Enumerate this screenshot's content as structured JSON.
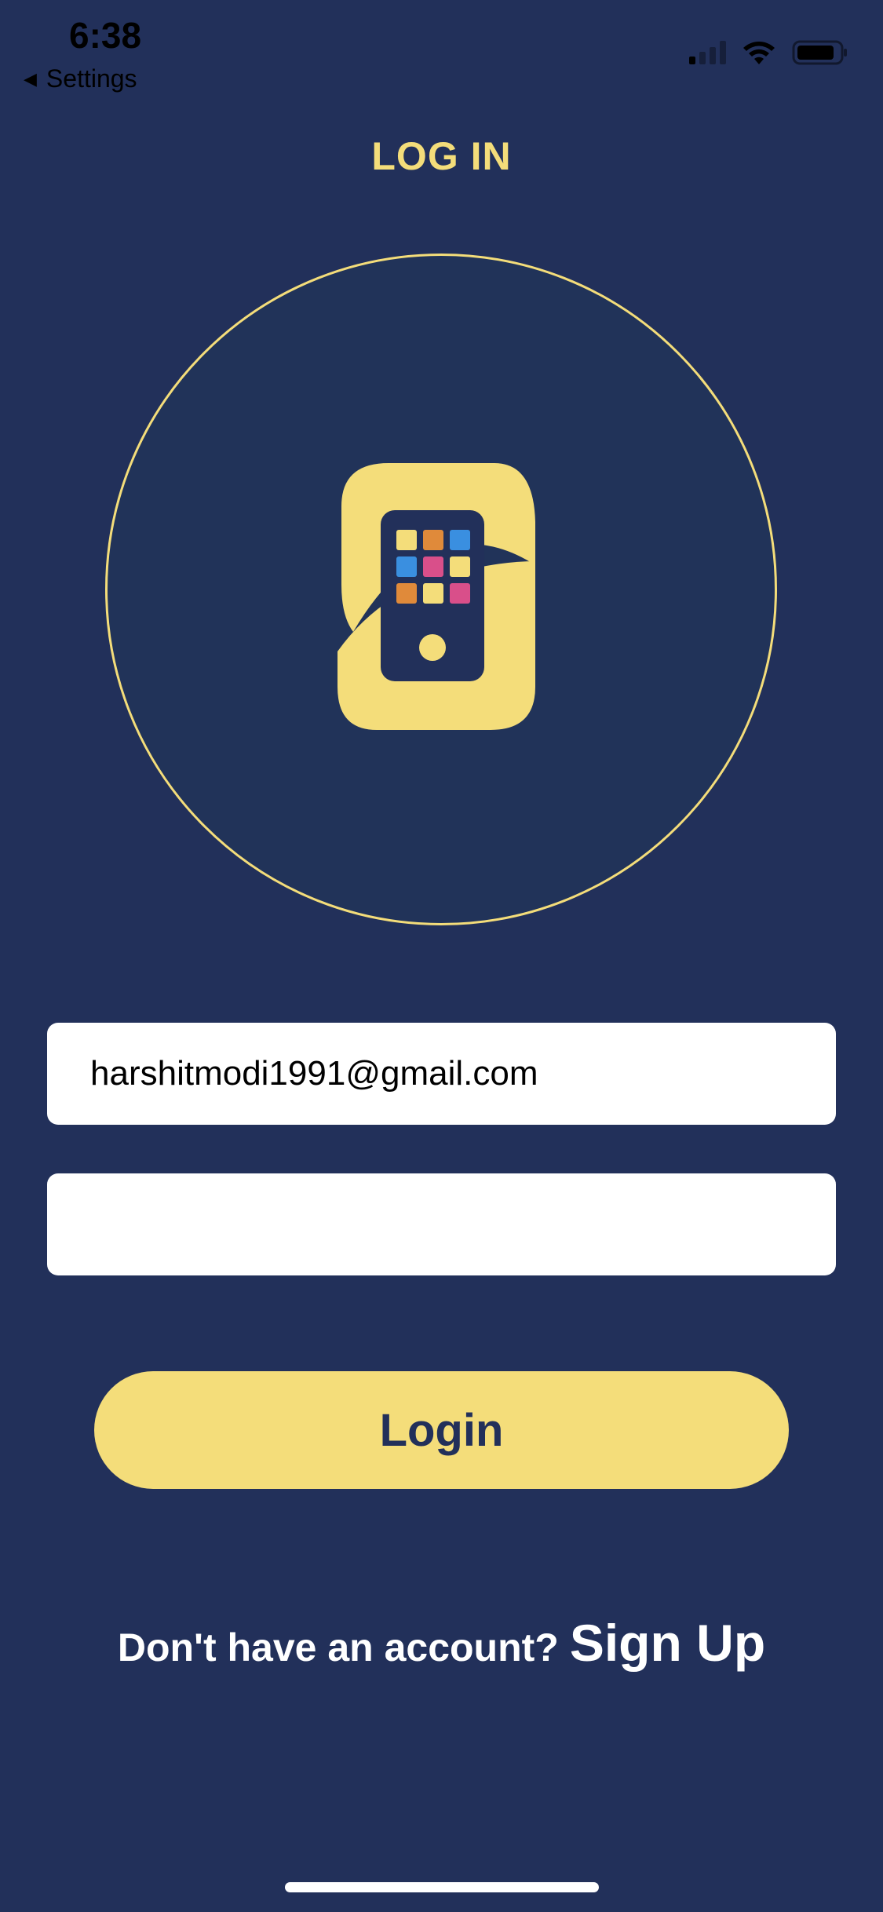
{
  "status_bar": {
    "time": "6:38",
    "back_label": "Settings",
    "icons": [
      "cellular-signal-icon",
      "wifi-icon",
      "battery-icon"
    ]
  },
  "header": {
    "title": "LOG IN"
  },
  "logo": {
    "icon": "app-logo-s-phone-icon"
  },
  "form": {
    "email_value": "harshitmodi1991@gmail.com",
    "password_value": "",
    "login_label": "Login"
  },
  "footer": {
    "prompt": "Don't have an account?",
    "signup_label": "Sign Up"
  },
  "colors": {
    "background": "#22305a",
    "accent": "#f4dd7a",
    "circle_fill": "#213359",
    "tile_blue": "#3a8fe0",
    "tile_orange": "#e08a3a",
    "tile_pink": "#d94f8a",
    "tile_yellow": "#f4dd7a"
  }
}
